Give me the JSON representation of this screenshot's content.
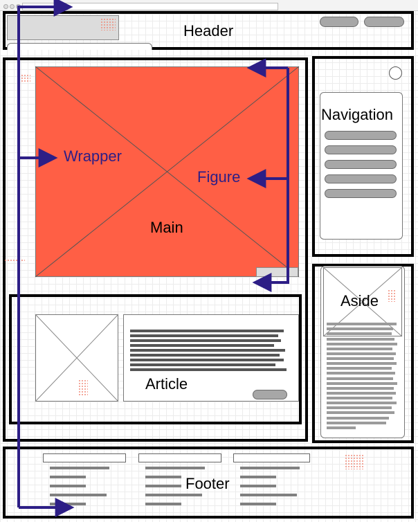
{
  "labels": {
    "header": "Header",
    "navigation": "Navigation",
    "wrapper": "Wrapper",
    "figure": "Figure",
    "main": "Main",
    "article": "Article",
    "aside": "Aside",
    "footer": "Footer"
  },
  "colors": {
    "figure_fill": "#ff5f45",
    "arrow": "#2d1e86",
    "frame": "#000000"
  }
}
